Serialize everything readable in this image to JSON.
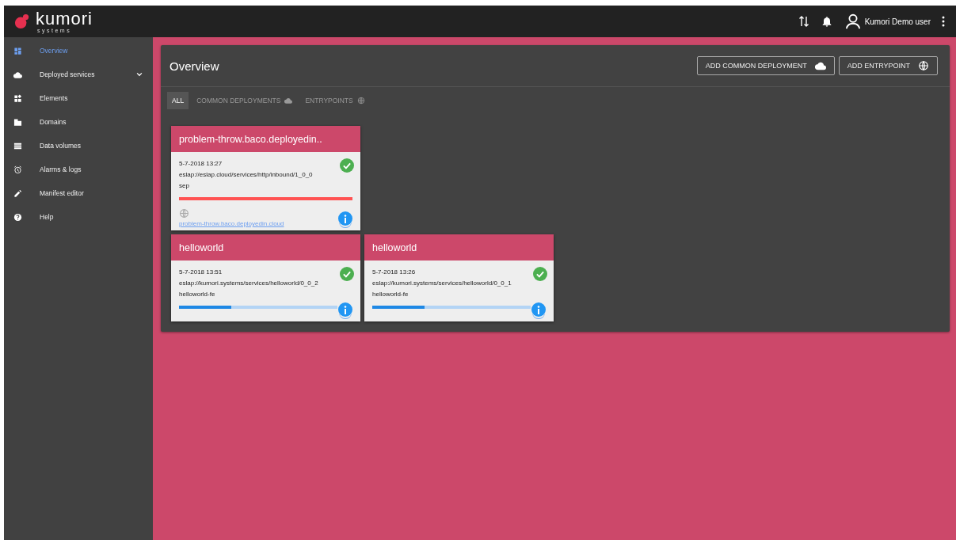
{
  "logo": {
    "name": "kumori",
    "tagline": "systems"
  },
  "topbar": {
    "user": "Kumori Demo user"
  },
  "sidebar": {
    "items": [
      {
        "label": "Overview",
        "selected": true
      },
      {
        "label": "Deployed services",
        "selected": false,
        "expandable": true
      },
      {
        "label": "Elements",
        "selected": false
      },
      {
        "label": "Domains",
        "selected": false
      },
      {
        "label": "Data volumes",
        "selected": false
      },
      {
        "label": "Alarms & logs",
        "selected": false
      },
      {
        "label": "Manifest editor",
        "selected": false
      },
      {
        "label": "Help",
        "selected": false
      }
    ]
  },
  "panel": {
    "title": "Overview",
    "buttons": [
      {
        "label": "ADD COMMON DEPLOYMENT"
      },
      {
        "label": "ADD ENTRYPOINT"
      }
    ],
    "tabs": [
      {
        "label": "ALL",
        "selected": true
      },
      {
        "label": "COMMON DEPLOYMENTS",
        "selected": false
      },
      {
        "label": "ENTRYPOINTS",
        "selected": false
      }
    ],
    "cards": [
      {
        "title": "problem-throw.baco.deployedin..",
        "date": "5-7-2018 13:27",
        "url": "eslap://eslap.cloud/services/http/inbound/1_0_0",
        "role": "sep",
        "ok": true,
        "kind": "error",
        "link": "problem-throw.baco.deployedin.cloud"
      },
      {
        "title": "helloworld",
        "date": "5-7-2018 13:51",
        "url": "eslap://kumori.systems/services/helloworld/0_0_2",
        "role": "helloworld-fe",
        "ok": true,
        "kind": "progress",
        "level": 0.33
      },
      {
        "title": "helloworld",
        "date": "5-7-2018 13:26",
        "url": "eslap://kumori.systems/services/helloworld/0_0_1",
        "role": "helloworld-fe",
        "ok": true,
        "kind": "progress",
        "level": 0.33
      }
    ]
  }
}
